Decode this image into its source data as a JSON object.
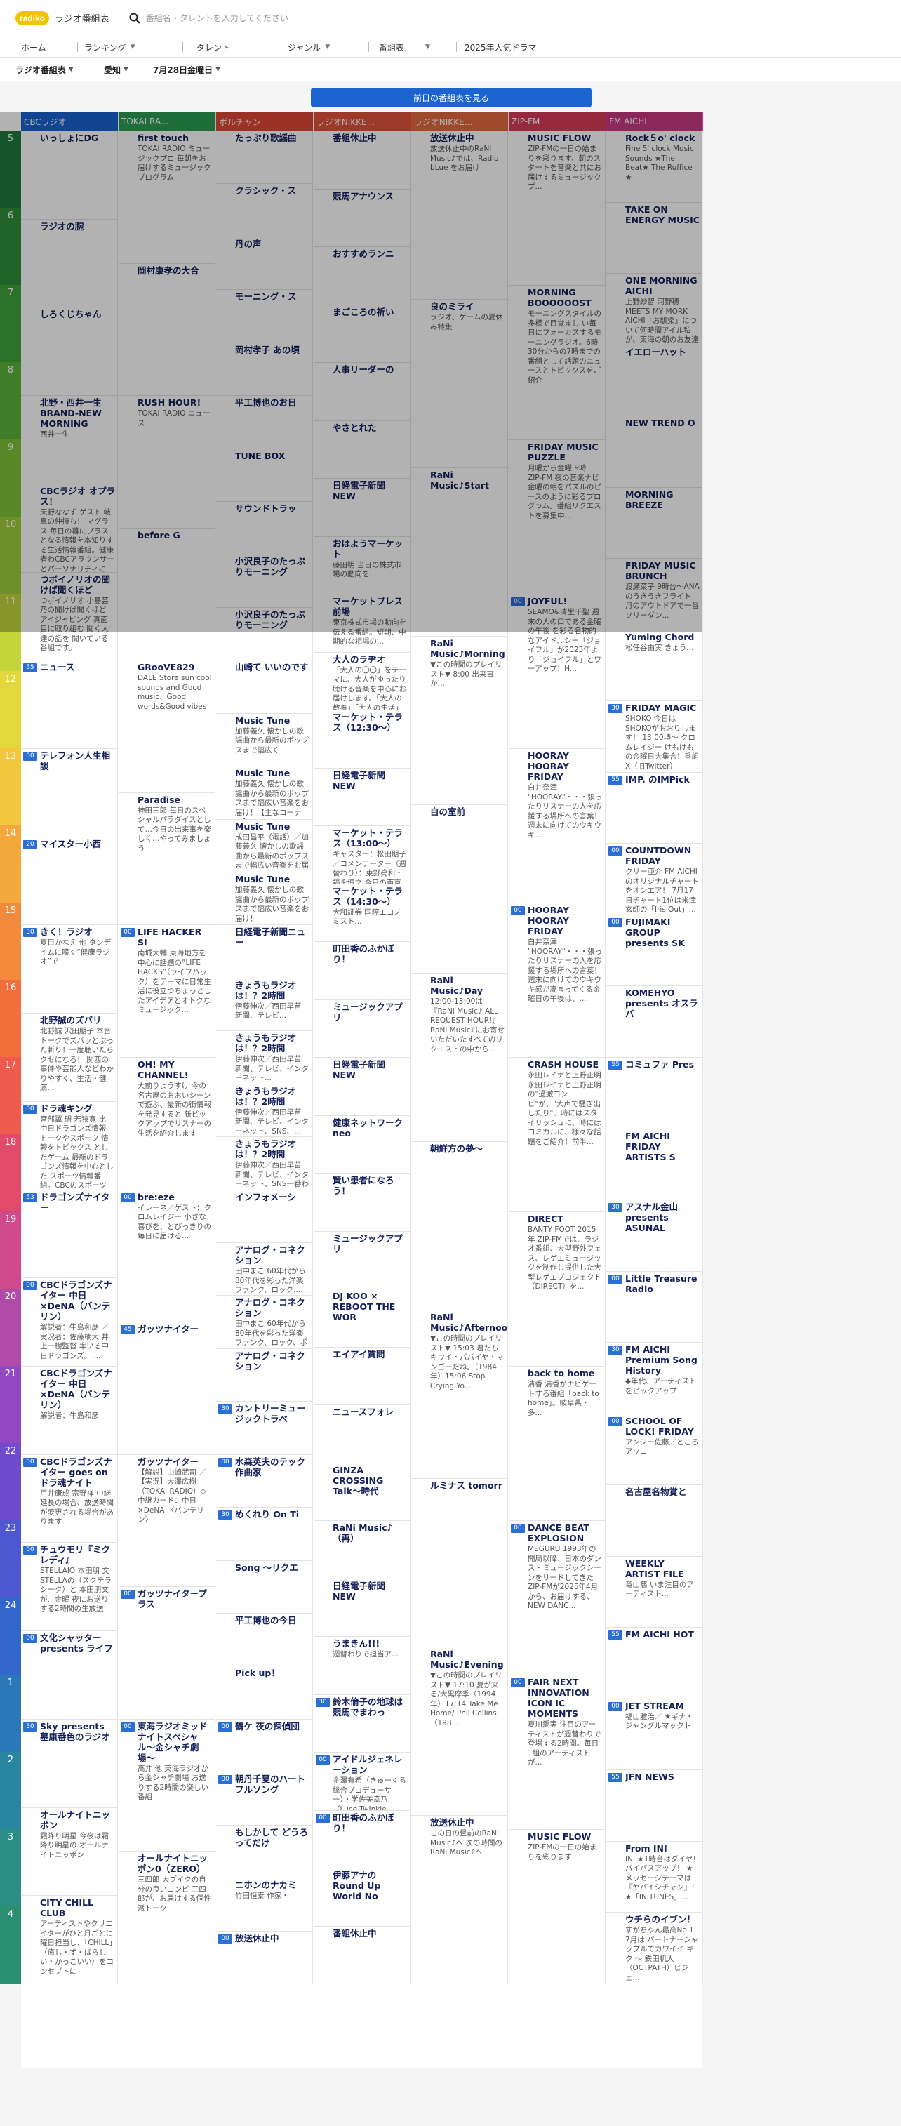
{
  "header": {
    "logo_mark": "radiko",
    "site_title": "ラジオ番組表",
    "search_placeholder": "番組名・タレントを入力してください"
  },
  "nav": [
    "ホーム",
    "ランキング",
    "タレント",
    "ジャンル",
    "番組表",
    "2025年人気ドラマ"
  ],
  "filters": {
    "region": "ラジオ番組表",
    "area": "愛知",
    "date": "7月28日金曜日"
  },
  "prev_day_button": "前日の番組表を見る",
  "hours": [
    "5",
    "6",
    "7",
    "8",
    "9",
    "10",
    "11",
    "12",
    "13",
    "14",
    "15",
    "16",
    "17",
    "18",
    "19",
    "20",
    "21",
    "22",
    "23",
    "24",
    "1",
    "2",
    "3",
    "4"
  ],
  "colors": {
    "hour_band": [
      "#1f7a3c",
      "#2f8f3a",
      "#3ea23a",
      "#5cb43a",
      "#7ec23a",
      "#9fce3a",
      "#c2d63b",
      "#e2d73b",
      "#f2c73b",
      "#f2a83b",
      "#f28a3b",
      "#f26e3b",
      "#ee5a4b",
      "#e24a6b",
      "#d04a8b",
      "#b24aa8",
      "#9248c0",
      "#6e4ccc",
      "#4e56d0",
      "#3266c8",
      "#2a78b8",
      "#2a86a0",
      "#2a8e86",
      "#2a9070"
    ]
  },
  "stations": [
    {
      "name": "CBCラジオ",
      "color": "#1b64d0",
      "programs": [
        {
          "m": "",
          "t": "いっしょにDG",
          "d": ""
        },
        {
          "m": "",
          "t": "ラジオの腕",
          "d": ""
        },
        {
          "m": "",
          "t": "しろくじちゃん",
          "d": ""
        },
        {
          "m": "",
          "t": "北野・西井一生 BRAND-NEW MORNING",
          "d": "西井一生"
        },
        {
          "m": "",
          "t": "CBCラジオ オプラス！",
          "d": "天野ななず ゲスト 岐阜の仲持ち！ マグラス 毎日の暮にプラスとなる情報を本知りする生活情報番組。健康者わCBCアラウンサー とパーソナリティに"
        },
        {
          "m": "",
          "t": "つボイノリオの聞けば聞くほど",
          "d": "つボイノリオ 小島芸乃の聞けば聞くほど アイジャビング 真面目に取り組む 聞く人達の話を 聞いている番組です。"
        },
        {
          "m": "55",
          "t": "ニュース",
          "d": ""
        },
        {
          "m": "00",
          "t": "テレフォン人生相談",
          "d": ""
        },
        {
          "m": "20",
          "t": "マイスター小西",
          "d": ""
        },
        {
          "m": "30",
          "t": "きく！ラジオ",
          "d": "夏目かなえ 他 タンデイムに喋く“健康ラジオ”で"
        },
        {
          "m": "",
          "t": "北野誠のズバリ",
          "d": "北野誠 沢田朋子 本音トークでズバッとぶった斬り！一度聴いたらクセになる！ 関西の事件や芸能人などわかりやすく、生活・健康..."
        },
        {
          "m": "00",
          "t": "ドラ魂キング",
          "d": "宮部翼 盟 若狭寛 比 中日ドラゴンズ情報 トークやスポーツ 情報をトピックス としたゲーム 最新のドラゴンズ情報を中心とした スポーツ情報番組。CBCのスポーツア..."
        },
        {
          "m": "53",
          "t": "ドラゴンズナイター",
          "d": ""
        },
        {
          "m": "00",
          "t": "CBCドラゴンズナイター 中日×DeNA（バンテリン）",
          "d": "解説者：牛島和彦 ／実況者：佐藤楠大 井上一樹監督 率いる中日ドラゴンズ。 ..."
        },
        {
          "m": "",
          "t": "CBCドラゴンズナイター 中日×DeNA（バンテリン）",
          "d": "解説者：牛島和彦"
        },
        {
          "m": "00",
          "t": "CBCドラゴンズナイター goes on ドラ魂ナイト",
          "d": "戸井康成 宗野祥 中継延長の場合、放送時間が変更される場合があります"
        },
        {
          "m": "00",
          "t": "チュウモリ『ミクレディ』",
          "d": "STELLAIO 本田朋 文 STELLAの（スクテラシーク）と 本田朋文が、金曜 夜にお送りする2時間の生放送"
        },
        {
          "m": "00",
          "t": "文化シャッターpresents ライフ",
          "d": ""
        },
        {
          "m": "30",
          "t": "Sky presents 墓康番色のラジオ",
          "d": ""
        },
        {
          "m": "",
          "t": "オールナイトニッポン",
          "d": "霜降り明星 今夜は霜降り明星の オールナイトニッポン"
        },
        {
          "m": "",
          "t": "CITY CHILL CLUB",
          "d": "アーティストやクリエイターがひと月ごとに曜日担当し、「CHILL」（癒し・ず・ばらしい・かっこいい）をコンセプトに"
        }
      ]
    },
    {
      "name": "TOKAI RA...",
      "color": "#2d9c52",
      "programs": [
        {
          "m": "",
          "t": "first touch",
          "d": "TOKAI RADIO ミュージックプロ 毎朝をお届けするミュージックプログラム"
        },
        {
          "m": "",
          "t": "岡村康孝の大合",
          "d": ""
        },
        {
          "m": "",
          "t": "RUSH HOUR!",
          "d": "TOKAI RADIO ニュース"
        },
        {
          "m": "",
          "t": "before G",
          "d": ""
        },
        {
          "m": "",
          "t": "GRooVE829",
          "d": "DALE Store sun cool sounds and Good music、Good words&Good vibes"
        },
        {
          "m": "",
          "t": "Paradise",
          "d": "神田三郎 毎日のスペシャルパラダイスとして…今日の出来事を楽しく…やってみましょう"
        },
        {
          "m": "00",
          "t": "LIFE HACKER SI",
          "d": "南城大輔 東海地方を中心に話題の”LIFE HACKS”（ライフハック）をテーマに日常生活に役立つちょっとしたアイデアとオトクなミュージック..."
        },
        {
          "m": "",
          "t": "OH! MY CHANNEL!",
          "d": "大前りょうすけ 今の名古屋のおおいシーンで遊ぶ、最新の街情報を発見すると 新ピックアップでリスナーの生活を紹介します"
        },
        {
          "m": "00",
          "t": "bre:eze",
          "d": "イレーネ／ゲスト：クロムレイジー 小さな喜びを、とびっきりの毎日に届ける..."
        },
        {
          "m": "45",
          "t": "ガッツナイター",
          "d": ""
        },
        {
          "m": "",
          "t": "ガッツナイター",
          "d": "【解説】山崎武司 ／【実況】大澤広樹（TOKAI RADIO）◇中継カード：中日×DeNA 〈バンテリン〉"
        },
        {
          "m": "00",
          "t": "ガッツナイタープラス",
          "d": ""
        },
        {
          "m": "00",
          "t": "東海ラジオミッドナイトスペシャル〜金シャチ劇場〜",
          "d": "高井 他 東海ラジオから金シャチ劇場 お送りする2時間の楽しい番組"
        },
        {
          "m": "",
          "t": "オールナイトニッポン0（ZERO）",
          "d": "三四郎 大ブイクの自分の良いコンビ 三四郎が、お届けする個性派トーク"
        }
      ]
    },
    {
      "name": "ボルチャン",
      "color": "#e04836",
      "programs": [
        {
          "m": "",
          "t": "たっぷり歌謡曲",
          "d": ""
        },
        {
          "m": "",
          "t": "クラシック・ス",
          "d": ""
        },
        {
          "m": "",
          "t": "丹の声",
          "d": ""
        },
        {
          "m": "",
          "t": "モーニング・ス",
          "d": ""
        },
        {
          "m": "",
          "t": "岡村孝子 あの頃",
          "d": ""
        },
        {
          "m": "",
          "t": "平工博也のお日",
          "d": ""
        },
        {
          "m": "",
          "t": "TUNE BOX",
          "d": ""
        },
        {
          "m": "",
          "t": "サウンドトラッ",
          "d": ""
        },
        {
          "m": "",
          "t": "小沢良子のたっぷりモーニング",
          "d": ""
        },
        {
          "m": "",
          "t": "小沢良子のたっぷりモーニング",
          "d": ""
        },
        {
          "m": "",
          "t": "山崎て いいのです",
          "d": ""
        },
        {
          "m": "",
          "t": "Music Tune",
          "d": "加藤義久 懐かしの歌謡曲から最新のポップスまで幅広く",
          "d2": ""
        },
        {
          "m": "",
          "t": "Music Tune",
          "d": "加藤義久 懐かしの歌謡曲から最新のポップスまで幅広い音楽をお届け！【主なコーナー】..."
        },
        {
          "m": "",
          "t": "Music Tune",
          "d": "成田昌平（電話）／加藤義久 懐かしの歌謡曲から最新のポップスまで幅広い音楽をお届け！"
        },
        {
          "m": "",
          "t": "Music Tune",
          "d": "加藤義久 懐かしの歌謡曲から最新のポップスまで幅広い音楽をお届け！"
        },
        {
          "m": "",
          "t": "日経電子新聞ニュー",
          "d": ""
        },
        {
          "m": "",
          "t": "きょうもラジオは！？2時間",
          "d": "伊藤伸次／西田早苗 新聞、テレビ..."
        },
        {
          "m": "",
          "t": "きょうもラジオは！？2時間",
          "d": "伊藤伸次／西田早苗 新聞、テレビ、インターネット..."
        },
        {
          "m": "",
          "t": "きょうもラジオは！？2時間",
          "d": "伊藤伸次／西田早苗 新聞、テレビ、インターネット、SNS、…"
        },
        {
          "m": "",
          "t": "きょうもラジオは！？2時間",
          "d": "伊藤伸次／西田早苗 新聞、テレビ、インターネット、SNS一番わかりやすく情報を尋ねてみます？"
        },
        {
          "m": "",
          "t": "インフォメーシ",
          "d": ""
        },
        {
          "m": "",
          "t": "アナログ・コネクション",
          "d": "田中まこ 60年代から80年代を彩った洋楽ファンク、ロック..."
        },
        {
          "m": "",
          "t": "アナログ・コネクション",
          "d": "田中まこ 60年代から80年代を彩った洋楽ファンク、ロック、ポップスを中心に全曲レコードでお届け"
        },
        {
          "m": "",
          "t": "アナログ・コネクション",
          "d": ""
        },
        {
          "m": "30",
          "t": "カントリーミュージックトラベ",
          "d": ""
        },
        {
          "m": "00",
          "t": "水森英夫のテック作曲家",
          "d": ""
        },
        {
          "m": "30",
          "t": "めくれり On Ti",
          "d": ""
        },
        {
          "m": "",
          "t": "Song 〜リクエ",
          "d": ""
        },
        {
          "m": "",
          "t": "平工博也の今日",
          "d": ""
        },
        {
          "m": "",
          "t": "Pick up！",
          "d": ""
        },
        {
          "m": "00",
          "t": "鶴ケ 夜の探偵団",
          "d": ""
        },
        {
          "m": "00",
          "t": "朝丹千夏のハートフルソング",
          "d": ""
        },
        {
          "m": "",
          "t": "もしかして どうろってだけ",
          "d": ""
        },
        {
          "m": "",
          "t": "ニホンのナカミ",
          "d": "竹田恒泰 作家・"
        },
        {
          "m": "00",
          "t": "放送休止中",
          "d": ""
        }
      ]
    },
    {
      "name": "ラジオNIKKE...",
      "color": "#e0523a",
      "programs": [
        {
          "m": "",
          "t": "番組休止中",
          "d": ""
        },
        {
          "m": "",
          "t": "競馬アナウンス",
          "d": ""
        },
        {
          "m": "",
          "t": "おすすめランニ",
          "d": ""
        },
        {
          "m": "",
          "t": "まごころの祈い",
          "d": ""
        },
        {
          "m": "",
          "t": "人事リーダーの",
          "d": ""
        },
        {
          "m": "",
          "t": "やさとれた",
          "d": ""
        },
        {
          "m": "",
          "t": "日経電子新聞NEW",
          "d": ""
        },
        {
          "m": "",
          "t": "おはようマーケット",
          "d": "藤田明 当日の株式市場の動向を..."
        },
        {
          "m": "",
          "t": "マーケットプレス 前場",
          "d": "東京株式市場の動向を伝える番組。短期、中期的な相場の..."
        },
        {
          "m": "",
          "t": "大人のラヂオ",
          "d": "「大人の〇〇」をテーマに、大人がゆったり聴ける音楽を中心にお届けします。「大人の教養」「大人の生活」「大人の食事」「大人のスポ..."
        },
        {
          "m": "",
          "t": "マーケット・テラス（12:30〜）",
          "d": ""
        },
        {
          "m": "",
          "t": "日経電子新聞NEW",
          "d": ""
        },
        {
          "m": "",
          "t": "マーケット・テラス（13:00〜）",
          "d": "キャスター：松田朋子／コメンテーター（週替わり）：東野亮和・福永博之 今日の東京株式市場を..."
        },
        {
          "m": "",
          "t": "マーケット・テラス（14:30〜）",
          "d": "大和証券 国際エコノミスト..."
        },
        {
          "m": "",
          "t": "町田香のふかぼり！",
          "d": ""
        },
        {
          "m": "",
          "t": "ミュージックアプリ",
          "d": ""
        },
        {
          "m": "",
          "t": "日経電子新聞NEW",
          "d": ""
        },
        {
          "m": "",
          "t": "健康ネットワーク neo",
          "d": ""
        },
        {
          "m": "",
          "t": "賢い患者になろう！",
          "d": ""
        },
        {
          "m": "",
          "t": "ミュージックアプリ",
          "d": ""
        },
        {
          "m": "",
          "t": "DJ KOO × REBOOT THE WOR",
          "d": ""
        },
        {
          "m": "",
          "t": "エイアイ質問",
          "d": ""
        },
        {
          "m": "",
          "t": "ニュースフォレ",
          "d": ""
        },
        {
          "m": "",
          "t": "GINZA CROSSING Talk〜時代",
          "d": ""
        },
        {
          "m": "",
          "t": "RaNi Music♪（再）",
          "d": ""
        },
        {
          "m": "",
          "t": "日経電子新聞NEW",
          "d": ""
        },
        {
          "m": "",
          "t": "うまきん!!!",
          "d": "週替わりで担当ア..."
        },
        {
          "m": "30",
          "t": "鈴木倫子の地球は競馬でまわっ",
          "d": ""
        },
        {
          "m": "00",
          "t": "アイドルジェネレーション",
          "d": "金澤有希（きゅーくる総合プロデューサー）・学佐美幸乃（Luce Twinkle Wink☆）ラジオNIKKEIが..."
        },
        {
          "m": "00",
          "t": "町田香のふかぼり！",
          "d": ""
        },
        {
          "m": "",
          "t": "伊藤アナの Round Up World No",
          "d": ""
        },
        {
          "m": "",
          "t": "番組休止中",
          "d": ""
        }
      ]
    },
    {
      "name": "ラジオNIKKE...",
      "color": "#e26840",
      "programs": [
        {
          "m": "",
          "t": "放送休止中",
          "d": "放送休止中のRaNi Music♪では、Radio bLue をお届け"
        },
        {
          "m": "",
          "t": "良のミライ",
          "d": "ラジオ、ゲームの夏休み特集"
        },
        {
          "m": "",
          "t": "RaNi Music♪Start",
          "d": ""
        },
        {
          "m": "",
          "t": "RaNi Music♪Morning",
          "d": "▼この時間のプレイリスト▼ 8:00 出来事か…"
        },
        {
          "m": "",
          "t": "自の室前",
          "d": ""
        },
        {
          "m": "",
          "t": "RaNi Music♪Day",
          "d": "12:00-13:00は『RaNi Music♪ ALL REQUEST HOUR!』RaNi Music♪にお寄せいただいたすべてのリクエストの中から..."
        },
        {
          "m": "",
          "t": "朝鮮方の夢〜",
          "d": ""
        },
        {
          "m": "",
          "t": "RaNi Music♪Afternoon",
          "d": "▼この時間のプレイリスト▼ 15:03 君たちキウイ・パパイヤ・マンゴーだね。（1984年）15:06 Stop Crying Yo..."
        },
        {
          "m": "",
          "t": "ルミナス tomorr",
          "d": ""
        },
        {
          "m": "",
          "t": "RaNi Music♪Evening",
          "d": "▼この時間のプレイリスト▼ 17:10 夏が来る/大黒摩季（1994年）17:14 Take Me Home/ Phil Collins（198..."
        },
        {
          "m": "",
          "t": "放送休止中",
          "d": "この日の昼前のRaNi Music♪へ 次の時間のRaNi Music♪へ"
        }
      ]
    },
    {
      "name": "ZIP-FM",
      "color": "#d83b5a",
      "programs": [
        {
          "m": "",
          "t": "MUSIC FLOW",
          "d": "ZIP-FMの一日の始まりを彩ります、朝のスタートを音楽と共にお届けするミュージックプ..."
        },
        {
          "m": "",
          "t": "MORNING BOOOOOOST",
          "d": "モーニングスタイルの多様で目覚まし い毎日にフォーカスするモーニングラジオ。6時30分からの7時までの番組として話題のニュースとトピックスをご紹介"
        },
        {
          "m": "",
          "t": "FRIDAY MUSIC PUZZLE",
          "d": "月曜から金曜 9時 ZIP-FM 夜の音楽ナビ 金曜の朝をパズルのピースのように彩るプログラム。番組リクエストを募集中..."
        },
        {
          "m": "00",
          "t": "JOYFUL!",
          "d": "SEAMO&清里千聖 週末の人の口である金曜の午後 を彩る名物的なアイドルシー「ジョイフル」が2023年より「ジョイフル」とワーアップ！H..."
        },
        {
          "m": "",
          "t": "HOORAY HOORAY FRIDAY",
          "d": "白井奈津 \"HOORAY\"・・・張ったりリスナーの人を応援する場所への言葉！ 週末に向けてのウキウキ..."
        },
        {
          "m": "00",
          "t": "HOORAY HOORAY FRIDAY",
          "d": "白井奈津 \"HOORAY\"・・・張ったりリスナーの人を応援する場所への言葉！ 週末に向けてのウキウキ感が高まってくる金曜日の午後は、..."
        },
        {
          "m": "",
          "t": "CRASH HOUSE",
          "d": "永田レイナと上野正明 永田レイナと上野正明の\"過激コンビ\"が、\"大声で騒ぎ出したり\"、時にはスタイリッシュに、時には コミカルに、様々な話題をご紹介！前半..."
        },
        {
          "m": "",
          "t": "DIRECT",
          "d": "BANTY FOOT 2015年 ZIP-FMでは、ラジオ番組、大型野外フェス、レゲエミュージックを制作し提供した大型レゲエプロジェクト（DIRECT）を..."
        },
        {
          "m": "",
          "t": "back to home",
          "d": "清香 清香がナビゲートする番組「back to home」。岐阜県・多..."
        },
        {
          "m": "00",
          "t": "DANCE BEAT EXPLOSION",
          "d": "MEGURU 1993年の開局以降、日本のダンス・ミュージックシーンをリードしてきたZIP-FMが2025年4月から、お届けする、NEW DANC..."
        },
        {
          "m": "00",
          "t": "FAIR NEXT INNOVATION ICON IC MOMENTS",
          "d": "夏川愛実 注目のアーティストが週替わりで登場する2時間。毎日1組のアーティストが..."
        },
        {
          "m": "",
          "t": "MUSIC FLOW",
          "d": "ZIP-FMの一日の始まりを彩ります"
        }
      ]
    },
    {
      "name": "FM AICHI",
      "color": "#c83a80",
      "programs": [
        {
          "m": "",
          "t": "Rock５o' clock",
          "d": "Fine 5' clock Music Sounds ★The Beat★ The Ruffice ★"
        },
        {
          "m": "",
          "t": "TAKE ON ENERGY MUSIC",
          "d": ""
        },
        {
          "m": "",
          "t": "ONE MORNING AICHI",
          "d": "上野紗智 河野穂 MEETS MY MORK AICHI「お馴染」について何時間アイル私が、東海の朝のお友達として..."
        },
        {
          "m": "",
          "t": "イエローハット",
          "d": ""
        },
        {
          "m": "",
          "t": "NEW TREND O",
          "d": ""
        },
        {
          "m": "",
          "t": "MORNING BREEZE",
          "d": ""
        },
        {
          "m": "",
          "t": "FRIDAY MUSIC BRUNCH",
          "d": "渡瀬菜子 9時台〜ANAのうきうきフライト 月のアウトドアで一番ソリーダン..."
        },
        {
          "m": "",
          "t": "Yuming Chord",
          "d": "松任谷由実 きょう..."
        },
        {
          "m": "30",
          "t": "FRIDAY MAGIC",
          "d": "SHOKO 今日はSHOKOがおおりします！ 13:00頃～ クロムレイジー けもけもの金曜日大集合！番組X（旧Twitter）★#fridaymagic807..."
        },
        {
          "m": "55",
          "t": "IMP. のIMPick",
          "d": ""
        },
        {
          "m": "00",
          "t": "COUNTDOWN FRIDAY",
          "d": "クリー亜介 FM AICHIのオリジナルチャートをオンエア！ 7月17日チャート1位は米津玄師の「Iris Out」..."
        },
        {
          "m": "00",
          "t": "FUJIMAKI GROUP presents SK",
          "d": ""
        },
        {
          "m": "",
          "t": "KOMEHYO presents オスラバ",
          "d": ""
        },
        {
          "m": "55",
          "t": "コミュファ Pres",
          "d": ""
        },
        {
          "m": "",
          "t": "FM AICHI FRIDAY ARTISTS S",
          "d": ""
        },
        {
          "m": "30",
          "t": "アスナル金山 presents ASUNAL",
          "d": ""
        },
        {
          "m": "00",
          "t": "Little Treasure Radio",
          "d": ""
        },
        {
          "m": "30",
          "t": "FM AICHI Premium Song History",
          "d": "◆年代、アーティストをピックアップ"
        },
        {
          "m": "00",
          "t": "SCHOOL OF LOCK! FRIDAY",
          "d": "アンジー佐藤／ところアッコ"
        },
        {
          "m": "",
          "t": "名古屋名物賞と",
          "d": ""
        },
        {
          "m": "",
          "t": "WEEKLY ARTIST FILE",
          "d": "竜山慈 いま注目のアーティスト..."
        },
        {
          "m": "55",
          "t": "FM AICHI HOT",
          "d": ""
        },
        {
          "m": "00",
          "t": "JET STREAM",
          "d": "福山雅治／ ★ギナ・ジャングルマックト"
        },
        {
          "m": "55",
          "t": "JFN NEWS",
          "d": ""
        },
        {
          "m": "",
          "t": "From INI",
          "d": "INI ★1時台はダイヤ！バイパスアップ！ ★メッセージテーマは『ヤバイシチャン』！ ★「INITUNES」..."
        },
        {
          "m": "",
          "t": "ウチらのイブン！",
          "d": "すがちゃん最高No.1 7月は パートナーシャップルでカワイイ キク 〜 鉄田机人（OCTPATH）ビジェ..."
        }
      ]
    }
  ]
}
